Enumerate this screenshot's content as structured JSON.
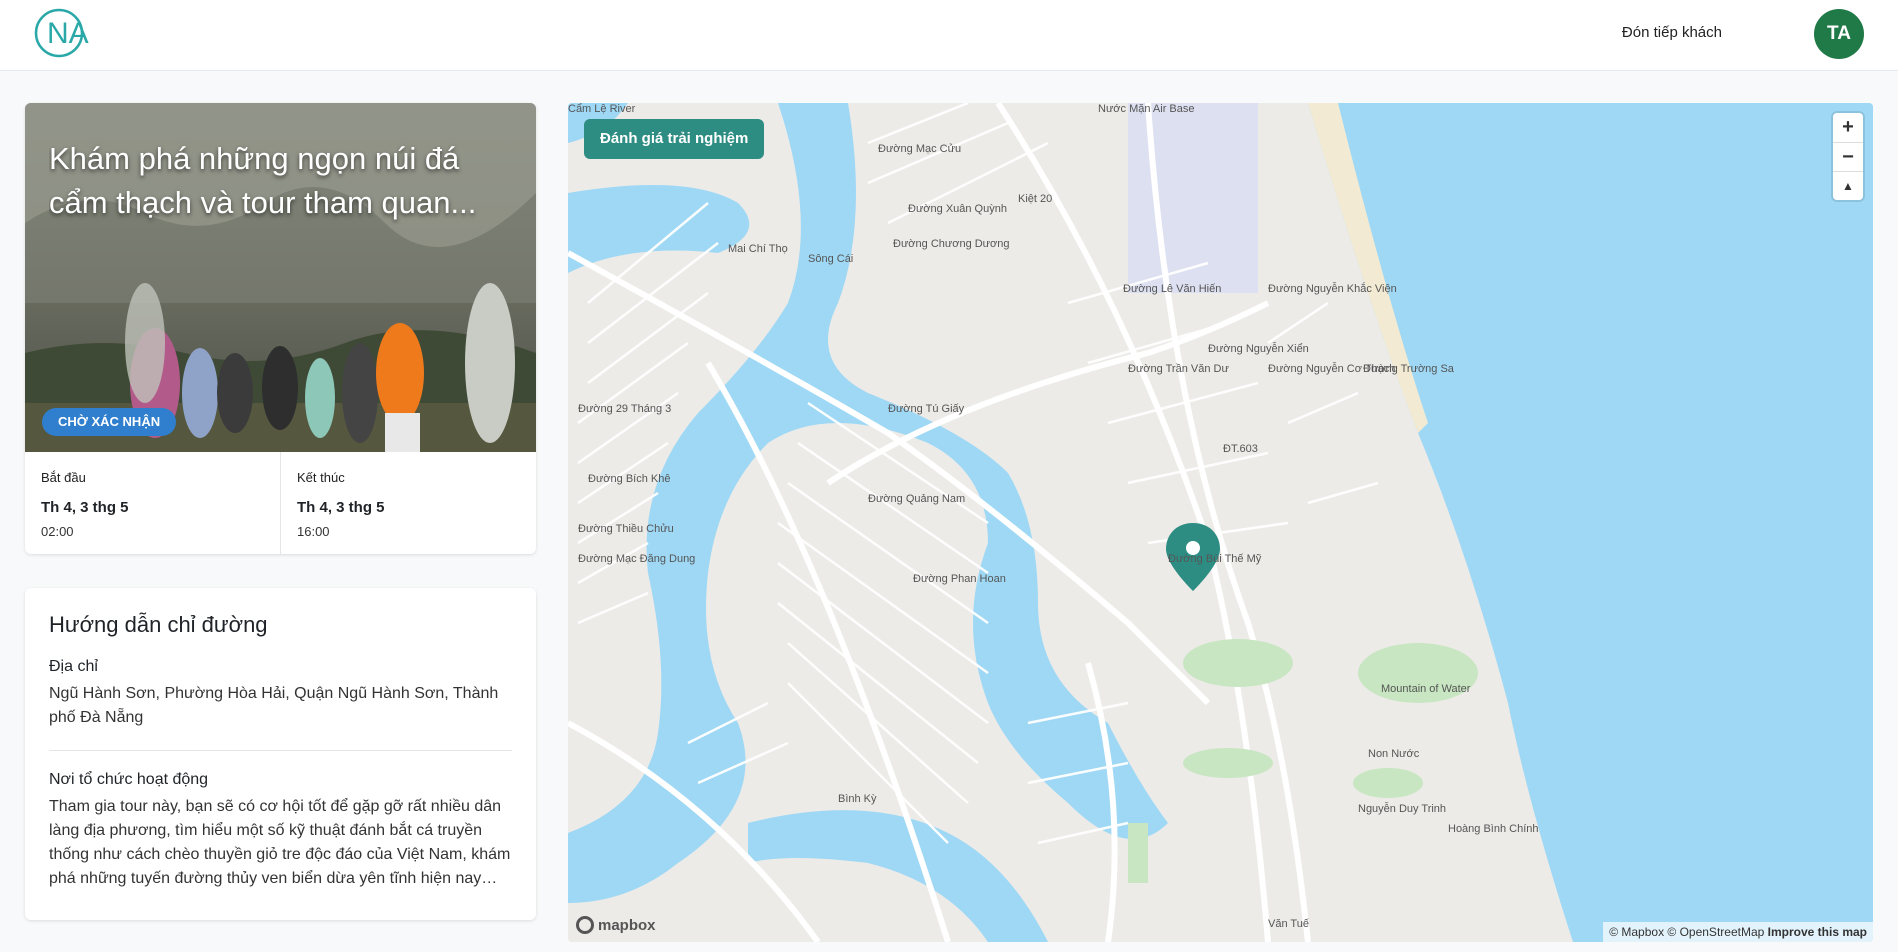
{
  "header": {
    "logo_text": "NA",
    "host_link": "Đón tiếp khách",
    "avatar_initials": "TA",
    "avatar_color": "#1f7a47",
    "brand_color": "#2aa8a8"
  },
  "booking": {
    "title": "Khám phá những ngọn núi đá cẩm thạch và tour tham quan...",
    "status": "CHỜ XÁC NHẬN",
    "status_color": "#2f7fce",
    "start": {
      "label": "Bắt đầu",
      "day": "Th 4, 3 thg 5",
      "time": "02:00"
    },
    "end": {
      "label": "Kết thúc",
      "day": "Th 4, 3 thg 5",
      "time": "16:00"
    }
  },
  "directions": {
    "title": "Hướng dẫn chỉ đường",
    "address_label": "Địa chỉ",
    "address": "Ngũ Hành Sơn, Phường Hòa Hải, Quận Ngũ Hành Sơn, Thành phố Đà Nẵng",
    "venue_label": "Nơi tổ chức hoạt động",
    "venue_text": "Tham gia tour này, bạn sẽ có cơ hội tốt để gặp gỡ rất nhiều dân làng địa phương, tìm hiểu một số kỹ thuật đánh bắt cá truyền thống như cách chèo thuyền giỏ tre độc đáo của Việt Nam, khám phá những tuyến đường thủy ven biển dừa yên tĩnh hiện nay của..."
  },
  "map": {
    "review_button": "Đánh giá trải nghiệm",
    "zoom_in": "+",
    "zoom_out": "−",
    "compass": "▲",
    "mapbox_logo": "mapbox",
    "attribution": "© Mapbox © OpenStreetMap",
    "improve": "Improve this map",
    "accent_color": "#2e8d83",
    "water_color": "#9ed8f5",
    "labels": [
      "Đường Mạc Cửu",
      "Đường Xuân Quỳnh",
      "Kiệt 20",
      "Đường Chương Dương",
      "Đường Lê Văn Hiến",
      "Đường Nguyễn Khắc Viện",
      "Đường Trường Sa",
      "Đường Trần Văn Dư",
      "Đường Nguyễn Xiển",
      "Đường Nguyễn Cơ Thạch",
      "ĐT.603",
      "Đường Tú Giấy",
      "Đường Quảng Nam",
      "Đường Phan Hoan",
      "Đường Bùi Thế Mỹ",
      "Mountain of Water",
      "Non Nước",
      "Nguyễn Duy Trinh",
      "Hoàng Bình Chính",
      "Sông Cái",
      "Mai Chí Thọ",
      "Đường 29 Tháng 3",
      "Đường Bích Khê",
      "Đường Thiều Chửu",
      "Đường Mạc Đăng Dung",
      "Bình Kỳ",
      "Nước Mặn Air Base",
      "Cẩm Lệ River",
      "Văn Tuế"
    ]
  }
}
